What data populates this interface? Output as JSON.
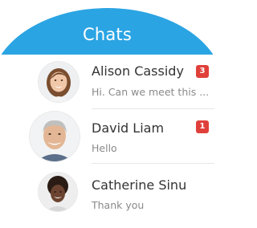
{
  "header": {
    "title": "Chats"
  },
  "chats": [
    {
      "name": "Alison Cassidy",
      "preview": "Hi. Can we meet this ...",
      "unread": "3",
      "avatar": "woman-smiling-avatar"
    },
    {
      "name": "David Liam",
      "preview": "Hello",
      "unread": "1",
      "avatar": "grey-haired-man-avatar"
    },
    {
      "name": "Catherine Sinu",
      "preview": "Thank you",
      "unread": "",
      "avatar": "woman-curly-hair-avatar"
    }
  ],
  "colors": {
    "header": "#2ba4e3",
    "badge": "#e0403a"
  },
  "more_indicator": "more-dots-icon"
}
